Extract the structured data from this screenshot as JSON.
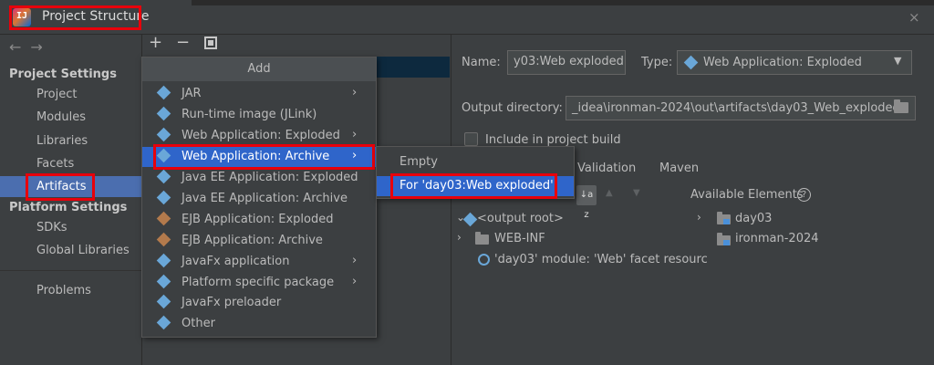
{
  "window": {
    "title": "Project Structure",
    "app_icon": "intellij-idea-icon",
    "close": "×"
  },
  "nav": {
    "back": "←",
    "forward": "→",
    "project_settings_header": "Project Settings",
    "project_settings_items": [
      "Project",
      "Modules",
      "Libraries",
      "Facets",
      "Artifacts"
    ],
    "selected": "Artifacts",
    "platform_settings_header": "Platform Settings",
    "platform_settings_items": [
      "SDKs",
      "Global Libraries"
    ],
    "problems": "Problems"
  },
  "toolbar": {
    "add": "+",
    "remove": "−",
    "copy_icon": "copy-icon"
  },
  "add_popup": {
    "header": "Add",
    "items": [
      {
        "label": "JAR",
        "submenu": true
      },
      {
        "label": "Run-time image (JLink)",
        "submenu": false
      },
      {
        "label": "Web Application: Exploded",
        "submenu": true
      },
      {
        "label": "Web Application: Archive",
        "submenu": true,
        "selected": true
      },
      {
        "label": "Java EE Application: Exploded",
        "submenu": false
      },
      {
        "label": "Java EE Application: Archive",
        "submenu": false
      },
      {
        "label": "EJB Application: Exploded",
        "submenu": false
      },
      {
        "label": "EJB Application: Archive",
        "submenu": false
      },
      {
        "label": "JavaFx application",
        "submenu": true
      },
      {
        "label": "Platform specific package",
        "submenu": true
      },
      {
        "label": "JavaFx preloader",
        "submenu": false
      },
      {
        "label": "Other",
        "submenu": false
      }
    ],
    "submenu_arrow": "›"
  },
  "submenu": {
    "items": [
      "Empty",
      "For 'day03:Web exploded'"
    ],
    "selected": "For 'day03:Web exploded'"
  },
  "artifact": {
    "name_label": "Name:",
    "name_value": "y03:Web exploded",
    "type_label": "Type:",
    "type_value": "Web Application: Exploded",
    "output_dir_label": "Output directory:",
    "output_dir_value": "_idea\\ironman-2024\\out\\artifacts\\day03_Web_exploded",
    "include_in_build_label": "Include in project build",
    "include_in_build_checked": false,
    "tabs": [
      "Validation",
      "Maven"
    ],
    "available_elements_label": "Available Elements",
    "help": "?",
    "sort_icon": "↓a z"
  },
  "output_tree": [
    {
      "label": "<output root>",
      "icon": "web-root-icon",
      "expanded": true
    },
    {
      "label": "WEB-INF",
      "icon": "folder-icon",
      "expanded": false
    },
    {
      "label": "'day03' module: 'Web' facet resourc",
      "icon": "web-facet-icon"
    }
  ],
  "available_tree": [
    {
      "label": "day03",
      "icon": "module-folder-icon"
    },
    {
      "label": "ironman-2024",
      "icon": "module-folder-icon"
    }
  ],
  "colors": {
    "background": "#3c3f41",
    "selection": "#2f65ca",
    "nav_selection": "#4b6eaf",
    "highlight": "#e8000b"
  }
}
